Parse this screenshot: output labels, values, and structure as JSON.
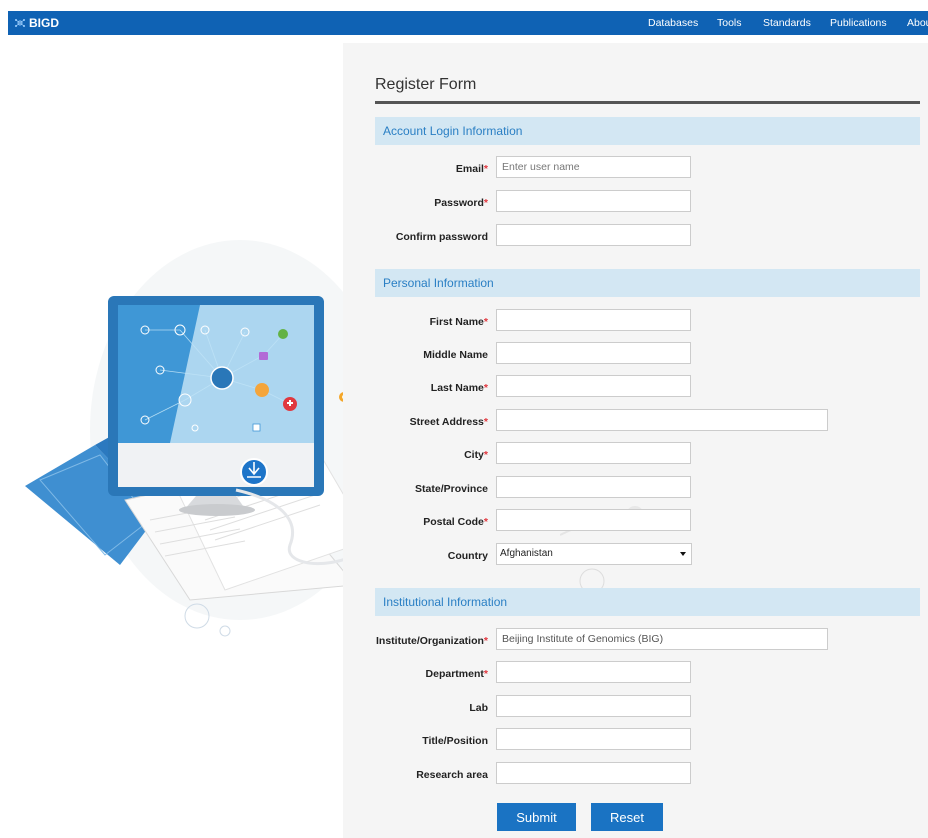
{
  "brand": {
    "name": "BIGD",
    "icon": "bigd-logo-icon"
  },
  "nav": {
    "items": [
      "Databases",
      "Tools",
      "Standards",
      "Publications",
      "Abou"
    ]
  },
  "form": {
    "title": "Register Form",
    "sections": {
      "account": "Account Login Information",
      "personal": "Personal Information",
      "institutional": "Institutional Information"
    },
    "fields": {
      "email": {
        "label": "Email",
        "placeholder": "Enter user name",
        "required": true
      },
      "password": {
        "label": "Password",
        "required": true
      },
      "confirm_password": {
        "label": "Confirm password",
        "required": false
      },
      "first_name": {
        "label": "First Name",
        "required": true
      },
      "middle_name": {
        "label": "Middle Name",
        "required": false
      },
      "last_name": {
        "label": "Last Name",
        "required": true
      },
      "street_address": {
        "label": "Street Address",
        "required": true
      },
      "city": {
        "label": "City",
        "required": true
      },
      "state": {
        "label": "State/Province",
        "required": false
      },
      "postal_code": {
        "label": "Postal Code",
        "required": true
      },
      "country": {
        "label": "Country",
        "value": "Afghanistan"
      },
      "institute": {
        "label": "Institute/Organization",
        "value": "Beijing Institute of Genomics (BIG)",
        "required": true
      },
      "department": {
        "label": "Department",
        "required": true
      },
      "lab": {
        "label": "Lab",
        "required": false
      },
      "title_position": {
        "label": "Title/Position",
        "required": false
      },
      "research_area": {
        "label": "Research area",
        "required": false
      }
    },
    "required_mark": "*",
    "buttons": {
      "submit": "Submit",
      "reset": "Reset"
    }
  },
  "colors": {
    "navbar": "#0f62b4",
    "section_bg": "#d3e7f3",
    "section_text": "#2a7fc4",
    "button": "#1a73c3",
    "required": "#e2373f"
  }
}
